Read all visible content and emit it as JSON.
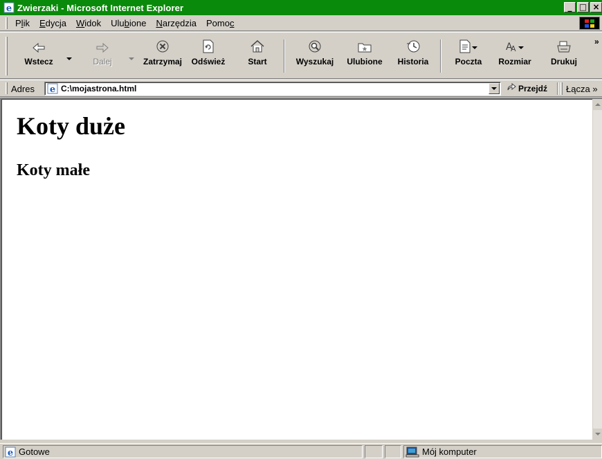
{
  "window": {
    "title": "Zwierzaki - Microsoft Internet Explorer",
    "minimize": "_",
    "maximize": "□",
    "close": "×"
  },
  "menu": [
    {
      "label": "Plik",
      "key": "l"
    },
    {
      "label": "Edycja",
      "key": "E"
    },
    {
      "label": "Widok",
      "key": "W"
    },
    {
      "label": "Ulubione",
      "key": "b"
    },
    {
      "label": "Narzędzia",
      "key": "N"
    },
    {
      "label": "Pomoc",
      "key": "c"
    }
  ],
  "toolbar": {
    "back": "Wstecz",
    "forward": "Dalej",
    "stop": "Zatrzymaj",
    "refresh": "Odśwież",
    "home": "Start",
    "search": "Wyszukaj",
    "favorites": "Ulubione",
    "history": "Historia",
    "mail": "Poczta",
    "size": "Rozmiar",
    "print": "Drukuj",
    "overflow": "»"
  },
  "address": {
    "label": "Adres",
    "value": "C:\\mojastrona.html",
    "go": "Przejdź",
    "links": "Łącza"
  },
  "page": {
    "h1": "Koty duże",
    "h2": "Koty małe"
  },
  "status": {
    "text": "Gotowe",
    "zone": "Mój komputer"
  },
  "colors": {
    "titlebar": "#0a8a0a",
    "chrome": "#d4d0c8"
  },
  "icons": [
    "ie-page-icon",
    "back-arrow-icon",
    "forward-arrow-icon",
    "stop-icon",
    "refresh-icon",
    "home-icon",
    "search-icon",
    "favorites-icon",
    "history-icon",
    "mail-icon",
    "font-size-icon",
    "print-icon",
    "go-arrow-icon",
    "computer-icon",
    "windows-logo-icon"
  ]
}
